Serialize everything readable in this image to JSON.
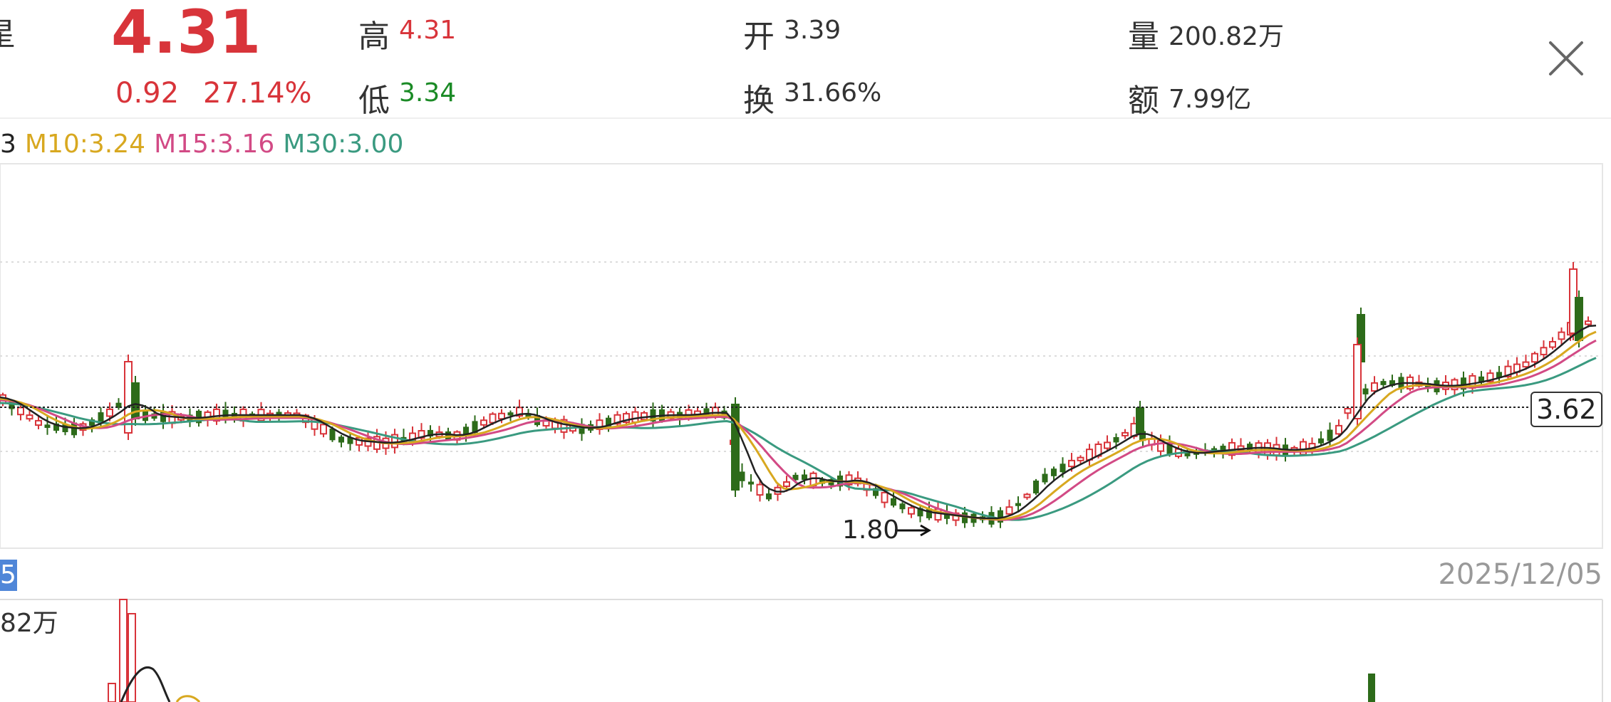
{
  "quote": {
    "name_fragment": "星",
    "price": "4.31",
    "change": "0.92",
    "change_pct": "27.14%",
    "high": {
      "label": "高",
      "value": "4.31"
    },
    "low": {
      "label": "低",
      "value": "3.34"
    },
    "open": {
      "label": "开",
      "value": "3.39"
    },
    "turnover": {
      "label": "换",
      "value": "31.66%"
    },
    "volume": {
      "label": "量",
      "value": "200.82万"
    },
    "amount": {
      "label": "额",
      "value": "7.99亿"
    }
  },
  "ma_legend": {
    "m5": "3",
    "m10": "M10:3.24",
    "m15": "M15:3.16",
    "m30": "M30:3.00"
  },
  "colors": {
    "up": "#d8343a",
    "down": "#2d6b1a",
    "m5": "#222222",
    "m10": "#d8a820",
    "m15": "#d24a85",
    "m30": "#3a9a80"
  },
  "chart": {
    "current_price_label": "3.62",
    "low_marker_label": "1.80",
    "date": "2025/12/05",
    "date_tag": "5",
    "volume_label": "82万"
  },
  "icons": {
    "close": "close-icon"
  }
}
